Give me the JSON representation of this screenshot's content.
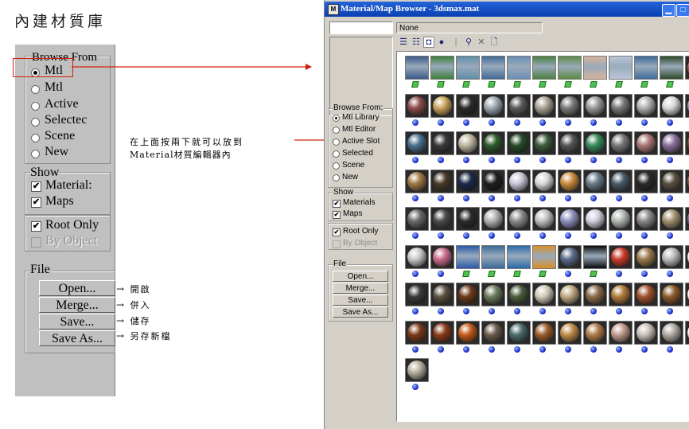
{
  "page_title": "內建材質庫",
  "zoom_panel": {
    "browse_from": {
      "legend": "Browse From",
      "options": [
        {
          "label": "Mtl",
          "selected": true
        },
        {
          "label": "Mtl",
          "selected": false
        },
        {
          "label": "Active",
          "selected": false
        },
        {
          "label": "Selectec",
          "selected": false
        },
        {
          "label": "Scene",
          "selected": false
        },
        {
          "label": "New",
          "selected": false
        }
      ]
    },
    "show": {
      "legend": "Show",
      "materials": "Material:",
      "maps": "Maps",
      "root_only": "Root Only",
      "by_object": "By Object"
    },
    "file": {
      "legend": "File",
      "open": "Open...",
      "merge": "Merge...",
      "save": "Save...",
      "save_as": "Save As..."
    }
  },
  "annotations": {
    "callout_line1": "在上面按兩下就可以放到",
    "callout_line2": "Material材質編輯器內",
    "open": "開啟",
    "merge": "併入",
    "save": "儲存",
    "save_as": "另存新檔"
  },
  "dialog": {
    "title": "Material/Map Browser - 3dsmax.mat",
    "title_icon": "M",
    "name_field": "None",
    "browse_from": {
      "legend": "Browse From:",
      "options": [
        {
          "label": "Mtl Library",
          "selected": true
        },
        {
          "label": "Mtl Editor",
          "selected": false
        },
        {
          "label": "Active Slot",
          "selected": false
        },
        {
          "label": "Selected",
          "selected": false
        },
        {
          "label": "Scene",
          "selected": false
        },
        {
          "label": "New",
          "selected": false
        }
      ]
    },
    "show": {
      "legend": "Show",
      "materials": "Materials",
      "maps": "Maps",
      "root_only": "Root Only",
      "by_object": "By Object"
    },
    "file": {
      "legend": "File",
      "open": "Open...",
      "merge": "Merge...",
      "save": "Save...",
      "save_as": "Save As..."
    }
  },
  "icons": {
    "list_view": "☰",
    "list_icons": "☷",
    "small_icons": "◘",
    "large_icons": "●",
    "update_scene": "⚲",
    "delete": "✕",
    "clear": "🗋"
  },
  "colors": {
    "titlebar": "#0a3fb0",
    "mtl_indicator": "#1a2fc8",
    "map_indicator": "#4ec24e",
    "annotation_arrow": "#d02010"
  },
  "materials": [
    [
      "map",
      "#3b5a8a"
    ],
    [
      "map",
      "#3f7f3a"
    ],
    [
      "map",
      "#5f8fa8"
    ],
    [
      "map",
      "#406a95"
    ],
    [
      "map",
      "#6b8fb5"
    ],
    [
      "map",
      "#4a7f3d"
    ],
    [
      "map",
      "#5c8a45"
    ],
    [
      "map",
      "#d7b49a"
    ],
    [
      "map",
      "#b9c6d8"
    ],
    [
      "map",
      "#3e6a9a"
    ],
    [
      "map",
      "#2f4a2a"
    ],
    [
      "mtl",
      "#9a6660"
    ],
    [
      "mtl",
      "#8a4a48"
    ],
    [
      "mtl",
      "#c9a35a"
    ],
    [
      "mtl",
      "#2a2a2a"
    ],
    [
      "mtl",
      "#9aa8b0"
    ],
    [
      "mtl",
      "#5a5a5a"
    ],
    [
      "mtl",
      "#aaa294"
    ],
    [
      "mtl",
      "#7a7a7a"
    ],
    [
      "mtl",
      "#999999"
    ],
    [
      "mtl",
      "#787878"
    ],
    [
      "mtl",
      "#b0b0b0"
    ],
    [
      "mtl",
      "#d8d8d8"
    ],
    [
      "mtl",
      "#8aa8c0"
    ],
    [
      "mtl",
      "#4a6f8f"
    ],
    [
      "mtl",
      "#3a3a3a"
    ],
    [
      "mtl",
      "#bdb59e"
    ],
    [
      "mtl",
      "#2e5a2a"
    ],
    [
      "mtl",
      "#274a27"
    ],
    [
      "mtl",
      "#3a5a3a"
    ],
    [
      "mtl",
      "#555555"
    ],
    [
      "mtl",
      "#3a8a5a"
    ],
    [
      "mtl",
      "#777777"
    ],
    [
      "mtl",
      "#aa7777"
    ],
    [
      "mtl",
      "#8a6f9a"
    ],
    [
      "mtl",
      "#8a4a2a"
    ],
    [
      "mtl",
      "#a07844"
    ],
    [
      "mtl",
      "#4a3a2a"
    ],
    [
      "mtl",
      "#1a2a4a"
    ],
    [
      "mtl",
      "#1e1e1e"
    ],
    [
      "mtl",
      "#c7c7d7"
    ],
    [
      "mtl",
      "#d8d8d8"
    ],
    [
      "mtl",
      "#c88a3a"
    ],
    [
      "mtl",
      "#6a7a8a"
    ],
    [
      "mtl",
      "#4a5a6a"
    ],
    [
      "mtl",
      "#2a2a2a"
    ],
    [
      "mtl",
      "#5a5040"
    ],
    [
      "mtl",
      "#8a6a3a"
    ],
    [
      "mtl",
      "#6a6a6a"
    ],
    [
      "mtl",
      "#4a4a4a"
    ],
    [
      "mtl",
      "#2a2a2a"
    ],
    [
      "mtl",
      "#b0b0b0"
    ],
    [
      "mtl",
      "#8a8a8a"
    ],
    [
      "mtl",
      "#c0c0c0"
    ],
    [
      "mtl",
      "#9090c0"
    ],
    [
      "mtl",
      "#d0d0e0"
    ],
    [
      "mtl",
      "#b0b8b0"
    ],
    [
      "mtl",
      "#888888"
    ],
    [
      "mtl",
      "#a09070"
    ],
    [
      "mtl",
      "#7a7aa0"
    ],
    [
      "mtl",
      "#c8c8c8"
    ],
    [
      "mtl",
      "#c86a8a"
    ],
    [
      "map",
      "#2a5aa8"
    ],
    [
      "map",
      "#3a6a9a"
    ],
    [
      "map",
      "#2a6aa8"
    ],
    [
      "map",
      "#d8902a"
    ],
    [
      "mtl",
      "#5a6a8a"
    ],
    [
      "map",
      "#0a0a0a"
    ],
    [
      "mtl",
      "#c83a2a"
    ],
    [
      "mtl",
      "#9a7a4a"
    ],
    [
      "mtl",
      "#bababa"
    ],
    [
      "mtl",
      "#ffffff"
    ],
    [
      "mtl",
      "#3a3a3a"
    ],
    [
      "mtl",
      "#5a5040"
    ],
    [
      "mtl",
      "#6a3a1a"
    ],
    [
      "mtl",
      "#6a7a5a"
    ],
    [
      "mtl",
      "#4a5a3a"
    ],
    [
      "mtl",
      "#d0c8b8"
    ],
    [
      "mtl",
      "#bda880"
    ],
    [
      "mtl",
      "#8a6a4a"
    ],
    [
      "mtl",
      "#b07a3a"
    ],
    [
      "mtl",
      "#a0522d"
    ],
    [
      "mtl",
      "#8a5a2a"
    ],
    [
      "mtl",
      "#ffffff"
    ],
    [
      "mtl",
      "#7a3a1a"
    ],
    [
      "mtl",
      "#8a3a1a"
    ],
    [
      "mtl",
      "#c05a1a"
    ],
    [
      "mtl",
      "#6a5a4a"
    ],
    [
      "mtl",
      "#4a6a6a"
    ],
    [
      "mtl",
      "#9a5a2a"
    ],
    [
      "mtl",
      "#c08a4a"
    ],
    [
      "mtl",
      "#b07a4a"
    ],
    [
      "mtl",
      "#c09a8a"
    ],
    [
      "mtl",
      "#c8c0b8"
    ],
    [
      "mtl",
      "#b0a8a0"
    ],
    [
      "mtl",
      "#ffffff"
    ],
    [
      "mtl",
      "#b8b0a0"
    ]
  ]
}
